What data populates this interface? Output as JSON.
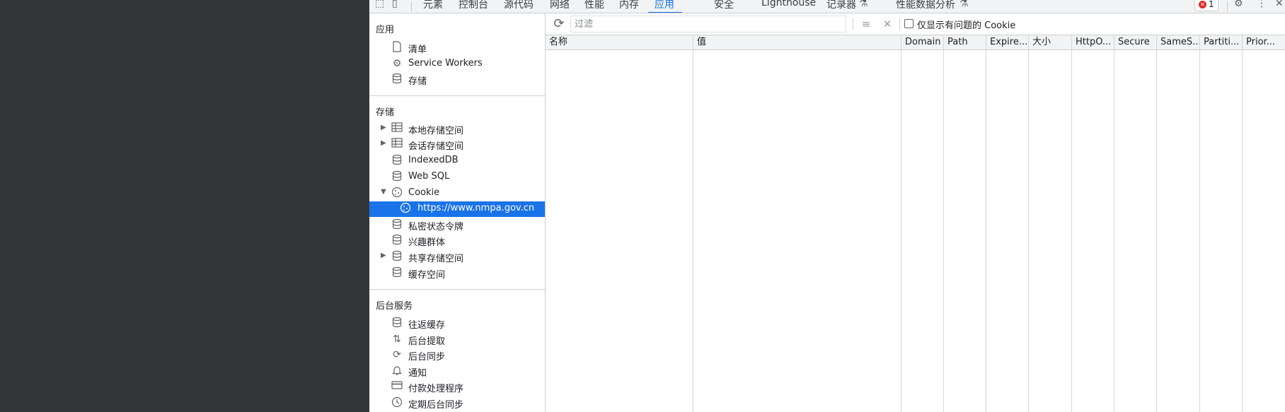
{
  "tabs": {
    "elements": "元素",
    "console": "控制台",
    "sources": "源代码",
    "network": "网络",
    "performance": "性能",
    "memory": "内存",
    "application": "应用",
    "security": "安全",
    "lighthouse": "Lighthouse",
    "recorder": "记录器",
    "performance_insights": "性能数据分析"
  },
  "error_count": "1",
  "sidebar": {
    "app_section": {
      "title": "应用",
      "items": [
        {
          "label": "清单",
          "icon": "document-icon"
        },
        {
          "label": "Service Workers",
          "icon": "gears-icon"
        },
        {
          "label": "存储",
          "icon": "database-icon"
        }
      ]
    },
    "storage_section": {
      "title": "存储",
      "items": [
        {
          "label": "本地存储空间",
          "icon": "table-icon"
        },
        {
          "label": "会话存储空间",
          "icon": "table-icon"
        },
        {
          "label": "IndexedDB",
          "icon": "database-icon"
        },
        {
          "label": "Web SQL",
          "icon": "database-icon"
        },
        {
          "label": "Cookie",
          "icon": "cookie-icon"
        },
        {
          "label": "https://www.nmpa.gov.cn",
          "icon": "cookie-icon"
        },
        {
          "label": "私密状态令牌",
          "icon": "database-icon"
        },
        {
          "label": "兴趣群体",
          "icon": "database-icon"
        },
        {
          "label": "共享存储空间",
          "icon": "database-icon"
        },
        {
          "label": "缓存空间",
          "icon": "database-icon"
        }
      ]
    },
    "background_section": {
      "title": "后台服务",
      "items": [
        {
          "label": "往返缓存",
          "icon": "database-icon"
        },
        {
          "label": "后台提取",
          "icon": "fetch-arrows-icon"
        },
        {
          "label": "后台同步",
          "icon": "sync-icon"
        },
        {
          "label": "通知",
          "icon": "bell-icon"
        },
        {
          "label": "付款处理程序",
          "icon": "card-icon"
        },
        {
          "label": "定期后台同步",
          "icon": "clock-icon"
        }
      ]
    }
  },
  "toolbar": {
    "filter_placeholder": "过滤",
    "only_issues_label": "仅显示有问题的 Cookie"
  },
  "table": {
    "headers": [
      "名称",
      "值",
      "Domain",
      "Path",
      "Expire...",
      "大小",
      "HttpO...",
      "Secure",
      "SameS...",
      "Partiti...",
      "Prior..."
    ]
  },
  "colors": {
    "accent": "#1a73e8",
    "dark_bg": "#35363a",
    "error": "#d93025"
  }
}
